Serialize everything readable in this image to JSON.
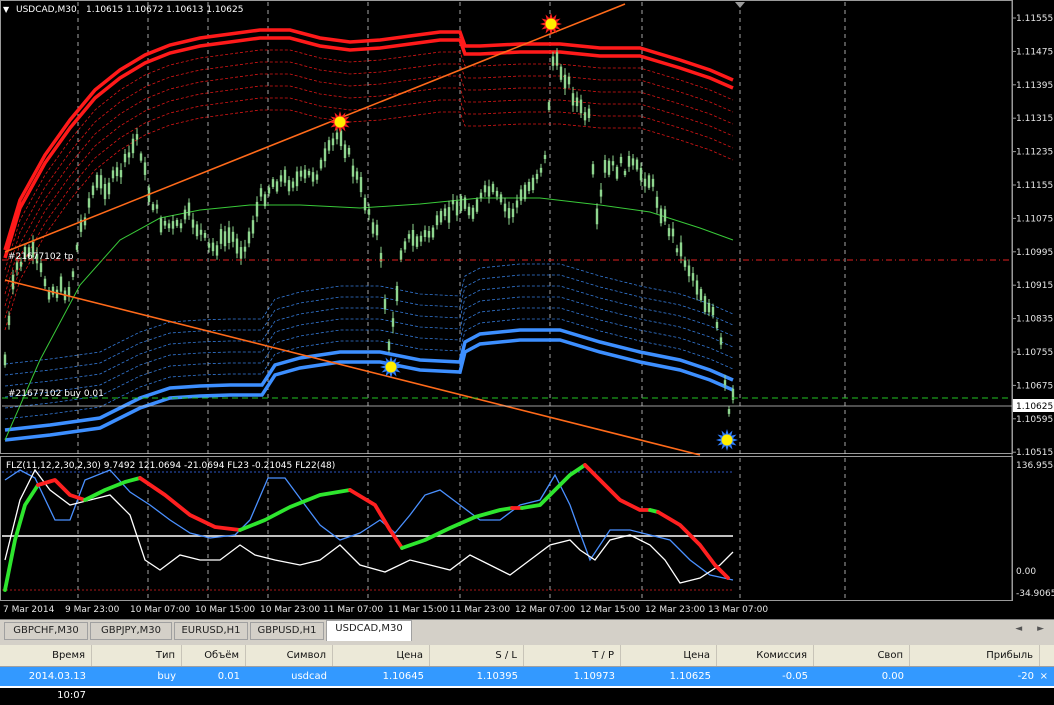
{
  "chart": {
    "title": "USDCAD,M30",
    "ohlc": "1.10615 1.10672 1.10613 1.10625",
    "tp_label": "#21677102 tp",
    "order_label": "#21677102 buy 0.01",
    "indicator_label": "FLZ(11,12,2,30,2,30) 9.7492 121.0694 -21.0694  FL23 -0.21045  FL22(48)",
    "y_ticks": [
      "1.11555",
      "1.11475",
      "1.11395",
      "1.11315",
      "1.11235",
      "1.11155",
      "1.11075",
      "1.10995",
      "1.10915",
      "1.10835",
      "1.10755",
      "1.10675",
      "1.10595",
      "1.10515"
    ],
    "current_price": "1.10625",
    "ind_ticks": [
      "136.9558",
      "0.00",
      "-34.9065"
    ],
    "x_ticks": [
      "7 Mar 2014",
      "9 Mar 23:00",
      "10 Mar 07:00",
      "10 Mar 15:00",
      "10 Mar 23:00",
      "11 Mar 07:00",
      "11 Mar 15:00",
      "11 Mar 23:00",
      "12 Mar 07:00",
      "12 Mar 15:00",
      "12 Mar 23:00",
      "13 Mar 07:00"
    ],
    "colors": {
      "up_band": "#ff1a1a",
      "down_band": "#3d8fff",
      "candle": "#8fd68f",
      "trend": "#ff6a1a",
      "ma": "#39c939",
      "signal_sell": "#ff2020",
      "signal_buy": "#2f7fff"
    }
  },
  "tabs": [
    {
      "label": "GBPCHF,M30",
      "active": false
    },
    {
      "label": "GBPJPY,M30",
      "active": false
    },
    {
      "label": "EURUSD,H1",
      "active": false
    },
    {
      "label": "GBPUSD,H1",
      "active": false
    },
    {
      "label": "USDCAD,M30",
      "active": true
    }
  ],
  "tab_arrows": "◄ ►",
  "trades": {
    "headers": [
      "Время",
      "Тип",
      "Объём",
      "Символ",
      "Цена",
      "S / L",
      "T / P",
      "Цена",
      "Комиссия",
      "Своп",
      "Прибыль"
    ],
    "rows": [
      [
        "2014.03.13 10:07",
        "buy",
        "0.01",
        "usdcad",
        "1.10645",
        "1.10395",
        "1.10973",
        "1.10625",
        "-0.05",
        "0.00",
        "-20"
      ]
    ],
    "close_icon": "×"
  }
}
